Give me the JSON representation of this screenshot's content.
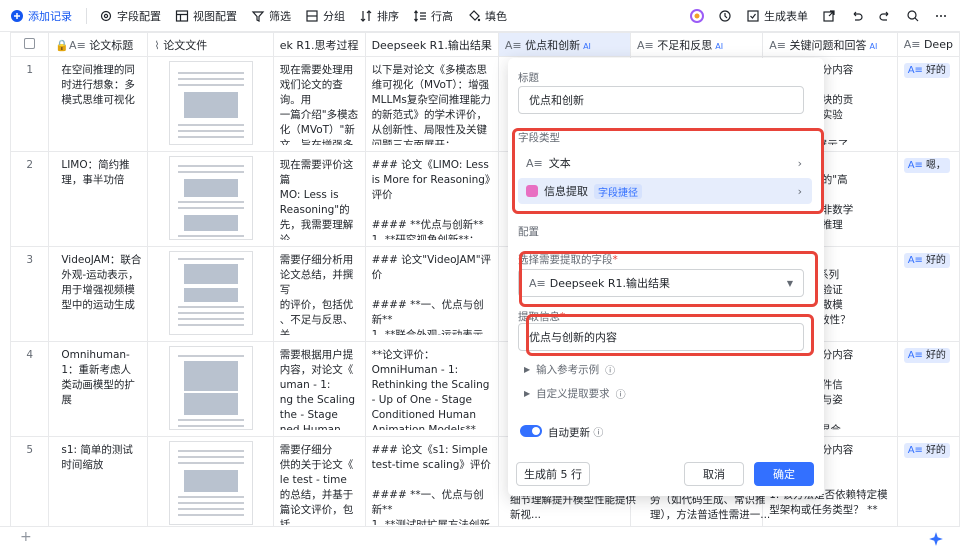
{
  "toolbar": {
    "add_record": "添加记录",
    "field_config": "字段配置",
    "view_config": "视图配置",
    "filter": "筛选",
    "group": "分组",
    "sort": "排序",
    "row_height": "行高",
    "fill": "填色",
    "generate_form": "生成表单"
  },
  "columns": [
    {
      "label": "论文标题",
      "icon": "lock-text-icon"
    },
    {
      "label": "论文文件",
      "icon": "attachment-icon"
    },
    {
      "label": "ek R1.思考过程"
    },
    {
      "label": "Deepseek R1.输出结果"
    },
    {
      "label": "优点和创新",
      "ai": "AI",
      "highlight": true
    },
    {
      "label": "不足和反思",
      "ai": "AI"
    },
    {
      "label": "关键问题和回答",
      "ai": "AI"
    },
    {
      "label": "Deep"
    }
  ],
  "rows": [
    {
      "num": "1",
      "title": "在空间推理的同时进行想象：多模式思维可视化",
      "think": "现在需要处理用\n戏们论文的查询。用\n 一篇介绍\"多模态\n 化（MVoT）\"新\n 文，旨在增强多模\n 言模型（MLLM...",
      "output": "以下是对论文《多模态思维可视化（MVoT）：增强MLLMs复杂空间推理能力的新范式》的学术评价，从创新性、局限性及关键问题三方面展开：...",
      "cons": "",
      "qa": "题及回答部分内容\n \n 何证明各模块的贡\n 否做过消融实验\n \n 文Table 3展示了...",
      "deep": "好的"
    },
    {
      "num": "2",
      "title": "LIMO：简约推理，事半功倍",
      "think": "现在需要评价这篇\n MO: Less is\n Reasoning\"的\n 先，我需要理解论\n 内容和贡献，然后\n 点、创新点，...",
      "output": "### 论文《LIMO: Less is More for Reasoning》评价\n\n#### **优点与创新**\n1. **研究视角创新**：...",
      "cons": "",
      "qa": "\n 保少量示例的\"高\n \"代表性\"？\n 是否适用于非数学\n 编程、法律推理",
      "deep": "嗯，"
    },
    {
      "num": "3",
      "title": "VideoJAM：联合外观-运动表示，用于增强视频模型中的运动生成",
      "think": "需要仔细分析用\n 论文总结，并撰写\n 的评价，包括优\n 、不足与反思、关\n 三个部分。首先\n 理解论文的核...",
      "output": "### 论文\"VideoJAM\"评价\n\n#### **一、优点与创新**\n1. **联合外观-运动表示的理论创新**\n   - 提出**联合建模外观...",
      "cons": "",
      "qa": "题及回答**\n 何选择DiT系列\n 模型？是否验证\n 架构（如扩散模\n N）上的有效性？",
      "deep": "好的"
    },
    {
      "num": "4",
      "title": "Omnihuman-1：重新考虑人类动画模型的扩展",
      "think": "需要根据用户提\n 内容，对论文《\n uman - 1:\n ng the Scaling\n the - Stage\n ned Human...",
      "output": "**论文评价：OmniHuman - 1: Rethinking the Scaling - Up of One - Stage Conditioned Human Animation Models**...",
      "cons": "",
      "qa": "题及回答部分内容\n \n 何解决多条件信\n 突（如音频与姿\n ？ **\n * 论文通过混合...",
      "deep": "好的"
    },
    {
      "num": "5",
      "title": "s1: 简单的测试时间缩放",
      "think": "需要仔细分\n 供的关于论文《\n le test - time\n 的总结，并基于\n 篇论文评价，包括\n 新、不足与反...",
      "output": "### 论文《s1: Simple test-time scaling》评价\n\n#### **一、优点与创新**\n1. **测试时扩展方法创新性突出**...",
      "cons": "",
      "qa": "题及回答部分内容\n \n 键问题：**\n 1. 该方法是否依赖特定模型架构或任务类型？ **",
      "deep": "好的"
    }
  ],
  "under_panel": {
    "adv_bottom": "细节理解提升模型性能提供新视...",
    "cons_bottom": "劳（如代码生成、常识推理），方法普适性需进一..."
  },
  "panel": {
    "title_label": "标题",
    "title_value": "优点和创新",
    "field_type_label": "字段类型",
    "type_text": "文本",
    "type_extract": "信息提取",
    "type_extract_tag": "字段捷径",
    "config_label": "配置",
    "select_field_label": "选择需要提取的字段",
    "required_mark": "*",
    "select_field_value": "Deepseek R1.输出结果",
    "extract_info_label": "提取信息",
    "extract_info_value": "优点与创新的内容",
    "add_examples": "输入参考示例",
    "custom_requirements": "自定义提取要求",
    "auto_update": "自动更新",
    "generate_preview": "生成前 5 行",
    "cancel": "取消",
    "confirm": "确定"
  },
  "colors": {
    "accent": "#3370ff",
    "highlight_red": "#e8443a",
    "header_highlight": "#e6edfc"
  }
}
